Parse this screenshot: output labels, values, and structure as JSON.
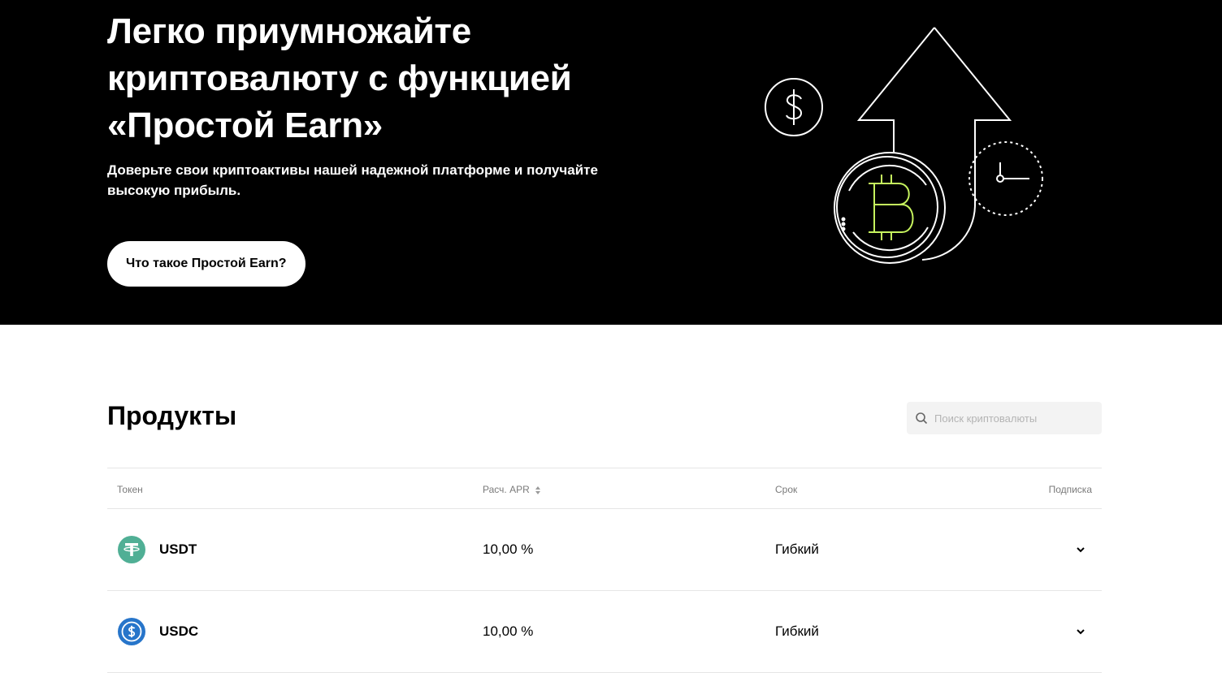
{
  "hero": {
    "title_line1": "Легко приумножайте",
    "title_line2": "криптовалюту с функцией",
    "title_line3": "«Простой Earn»",
    "subtitle_line1": "Доверьте свои криптоактивы нашей надежной платформе и получайте",
    "subtitle_line2": "высокую прибыль.",
    "button_label": "Что такое Простой Earn?",
    "illustration_icons": [
      "dollar-coin-icon",
      "up-arrow-icon",
      "bitcoin-coin-icon",
      "clock-icon"
    ],
    "accent_color": "#c6f35e"
  },
  "products": {
    "title": "Продукты",
    "search_placeholder": "Поиск криптовалюты",
    "columns": {
      "token": "Токен",
      "apr": "Расч. APR",
      "term": "Срок",
      "subscription": "Подписка"
    },
    "rows": [
      {
        "token": "USDT",
        "apr": "10,00 %",
        "term": "Гибкий",
        "icon": "usdt-icon",
        "color": "#50af95"
      },
      {
        "token": "USDC",
        "apr": "10,00 %",
        "term": "Гибкий",
        "icon": "usdc-icon",
        "color": "#2775ca"
      }
    ]
  }
}
